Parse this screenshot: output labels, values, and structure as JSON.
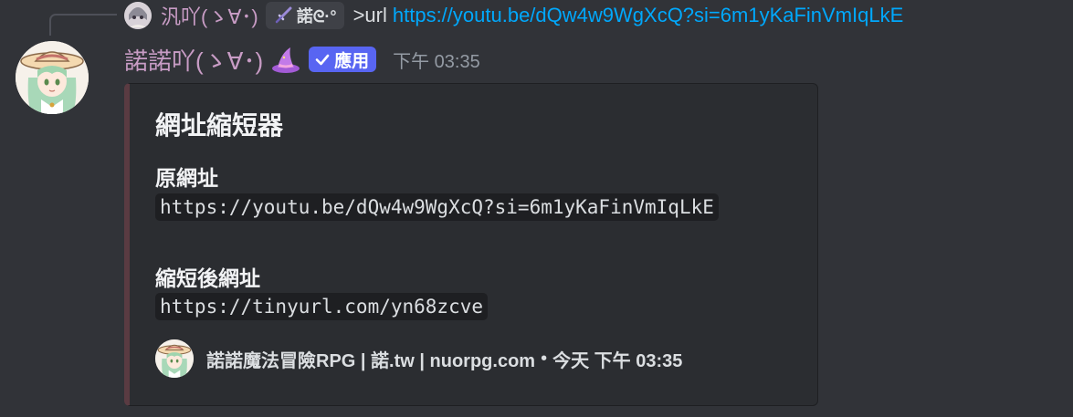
{
  "reply": {
    "author": "汎吖(ゝ∀･)",
    "guild_tag": "諾ᘓ·°",
    "text": ">url",
    "link": "https://youtu.be/dQw4w9WgXcQ?si=6m1yKaFinVmIqLkE"
  },
  "message": {
    "author": "諾諾吖(ゝ∀･)",
    "app_badge": "應用",
    "timestamp": "下午 03:35"
  },
  "embed": {
    "title": "網址縮短器",
    "fields": [
      {
        "name": "原網址",
        "value": "https://youtu.be/dQw4w9WgXcQ?si=6m1yKaFinVmIqLkE"
      },
      {
        "name": "縮短後網址",
        "value": "https://tinyurl.com/yn68zcve"
      }
    ],
    "footer": {
      "text": "諾諾魔法冒險RPG | 諾.tw | nuorpg.com",
      "separator": "•",
      "time": "今天 下午 03:35"
    },
    "accent_color": "#5a3b42"
  },
  "colors": {
    "background": "#313338",
    "author": "#c89cc5",
    "link": "#00a8fc",
    "badge": "#5865f2"
  },
  "icons": {
    "reply_avatar": "anime-avatar-icon",
    "hat": "witch-hat-icon",
    "check": "check-icon",
    "sword": "sword-icon"
  }
}
